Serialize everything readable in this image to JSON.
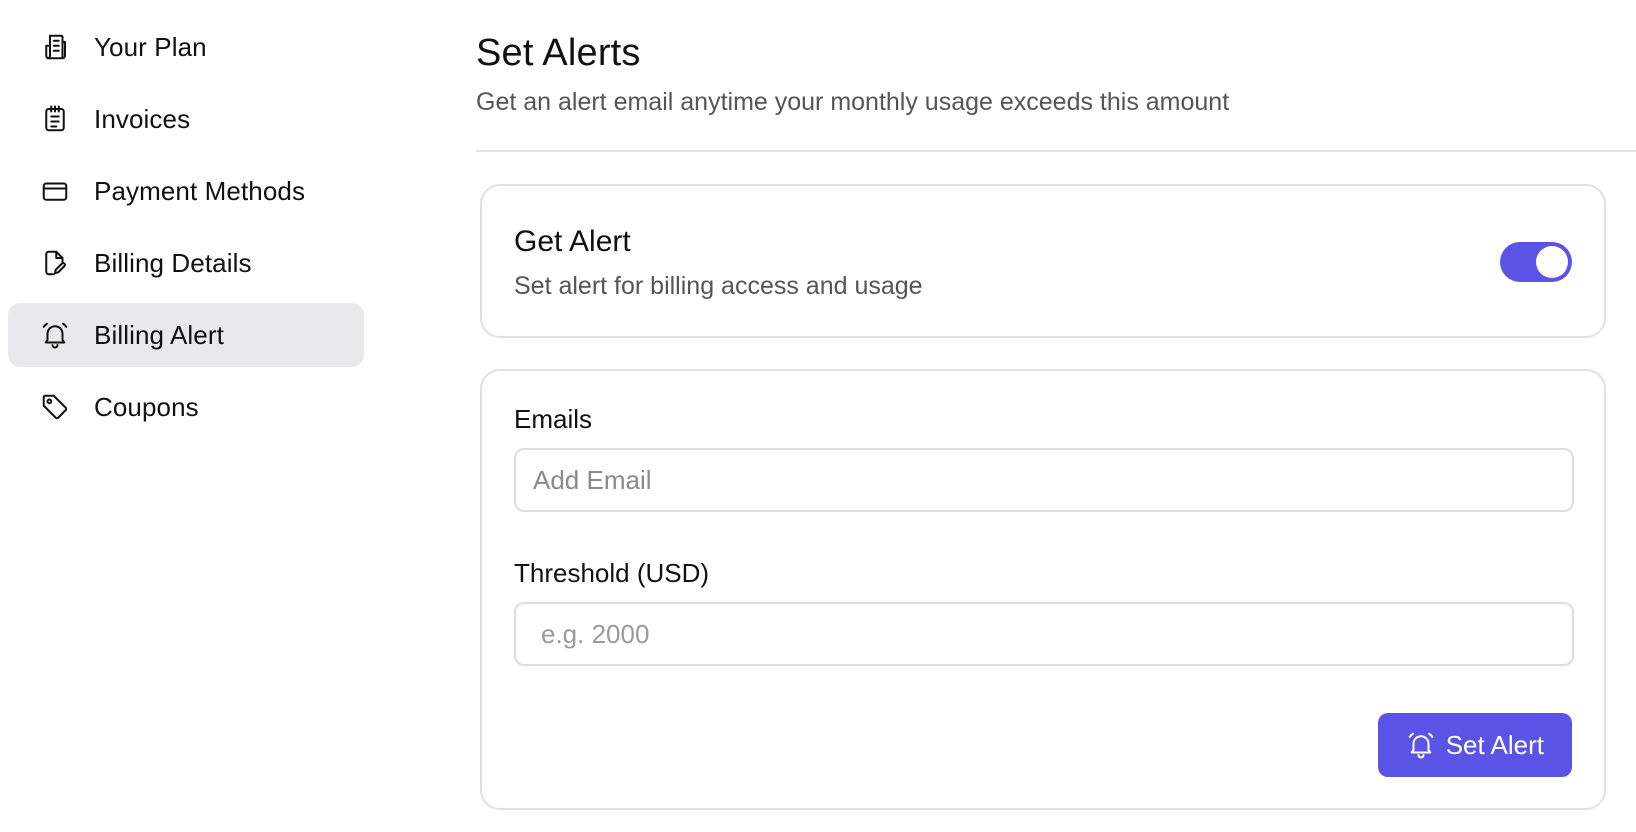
{
  "sidebar": {
    "items": [
      {
        "label": "Your Plan",
        "icon": "document-stack-icon",
        "active": false
      },
      {
        "label": "Invoices",
        "icon": "clipboard-list-icon",
        "active": false
      },
      {
        "label": "Payment Methods",
        "icon": "credit-card-icon",
        "active": false
      },
      {
        "label": "Billing Details",
        "icon": "file-edit-icon",
        "active": false
      },
      {
        "label": "Billing Alert",
        "icon": "bell-ringing-icon",
        "active": true
      },
      {
        "label": "Coupons",
        "icon": "tag-icon",
        "active": false
      }
    ]
  },
  "main": {
    "title": "Set Alerts",
    "subtitle": "Get an alert email anytime your monthly usage exceeds this amount"
  },
  "alert_toggle": {
    "title": "Get Alert",
    "description": "Set alert for billing access and usage",
    "enabled": true
  },
  "form": {
    "emails_label": "Emails",
    "emails_placeholder": "Add Email",
    "emails_value": "",
    "threshold_label": "Threshold (USD)",
    "threshold_placeholder": "e.g. 2000",
    "threshold_value": "",
    "submit_label": "Set Alert",
    "submit_icon": "bell-ringing-icon"
  },
  "colors": {
    "accent": "#5b52e6",
    "active_nav_bg": "#e9e9eb",
    "border": "#e1e1e1",
    "muted_text": "#555555"
  }
}
